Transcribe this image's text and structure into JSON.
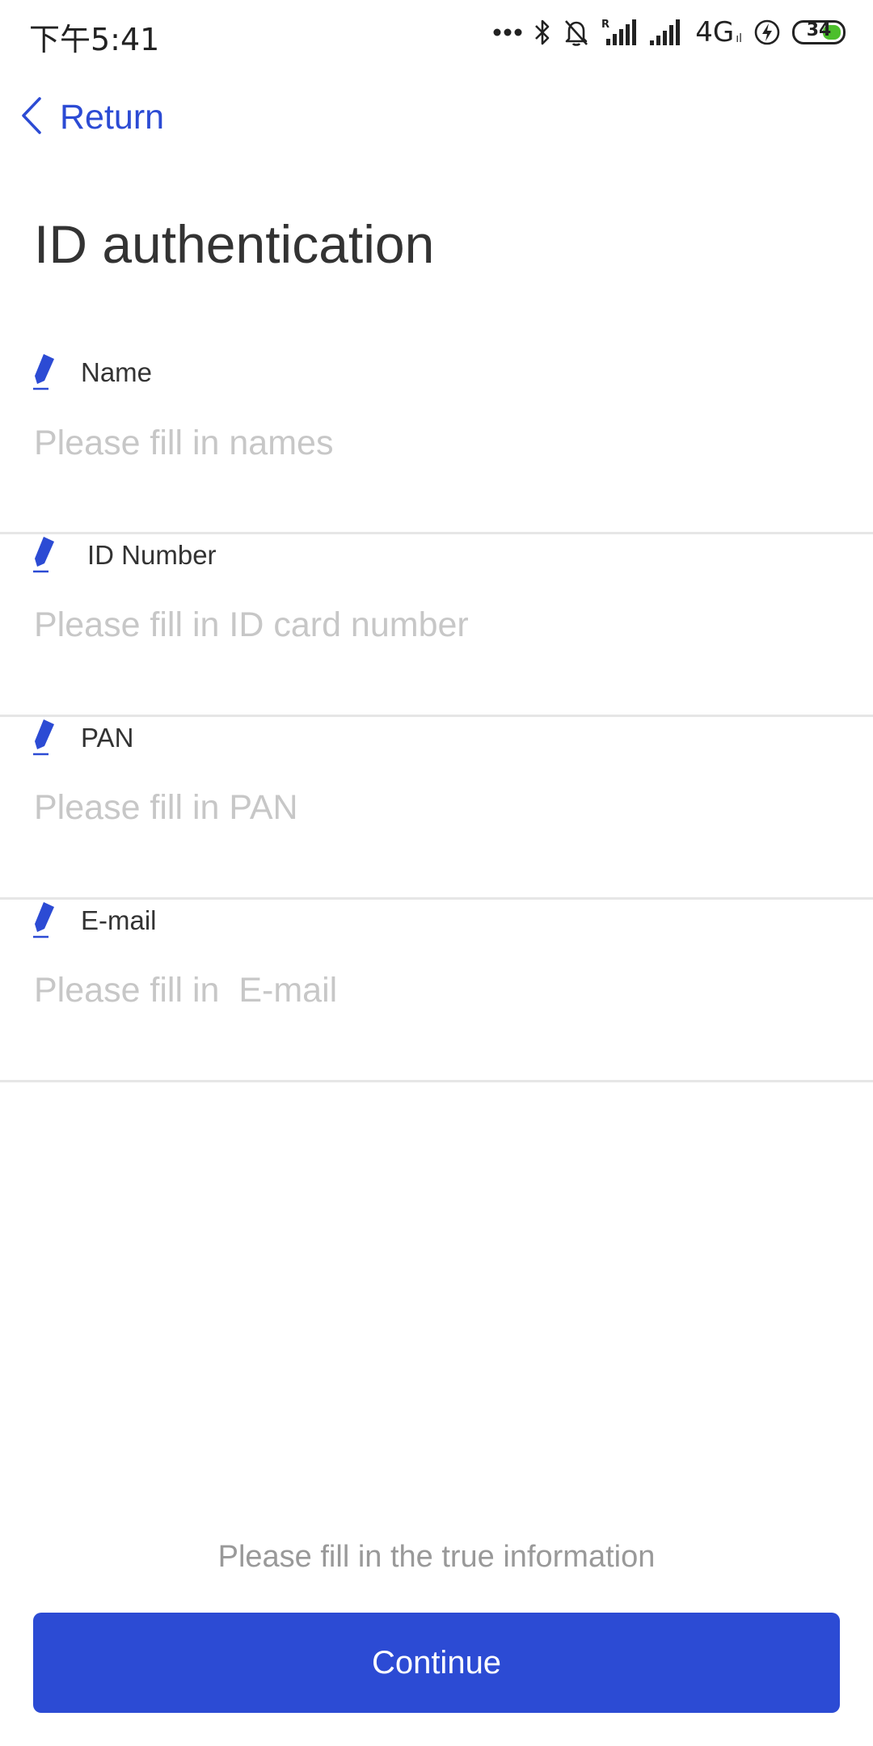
{
  "status_bar": {
    "time": "下午5:41",
    "network": "4G",
    "network_sub": "ıl",
    "battery_level": "34",
    "icons": [
      "more-dots-icon",
      "bluetooth-icon",
      "bell-muted-icon",
      "signal-roaming-icon",
      "signal-icon",
      "charging-icon",
      "battery-icon"
    ]
  },
  "nav": {
    "back_label": "Return"
  },
  "page": {
    "title": "ID authentication"
  },
  "form": {
    "fields": [
      {
        "label": "Name",
        "placeholder": "Please fill in names",
        "value": ""
      },
      {
        "label": "ID Number",
        "placeholder": "Please fill in ID card number",
        "value": ""
      },
      {
        "label": "PAN",
        "placeholder": "Please fill in PAN",
        "value": ""
      },
      {
        "label": "E-mail",
        "placeholder": "Please fill in  E-mail",
        "value": ""
      }
    ]
  },
  "footer": {
    "hint": "Please fill in the true information",
    "continue_label": "Continue"
  },
  "colors": {
    "accent": "#2c4bd4",
    "placeholder": "#c7c7c7",
    "divider": "#e6e6e6",
    "hint": "#999999",
    "battery_fill": "#4cbf2b"
  }
}
